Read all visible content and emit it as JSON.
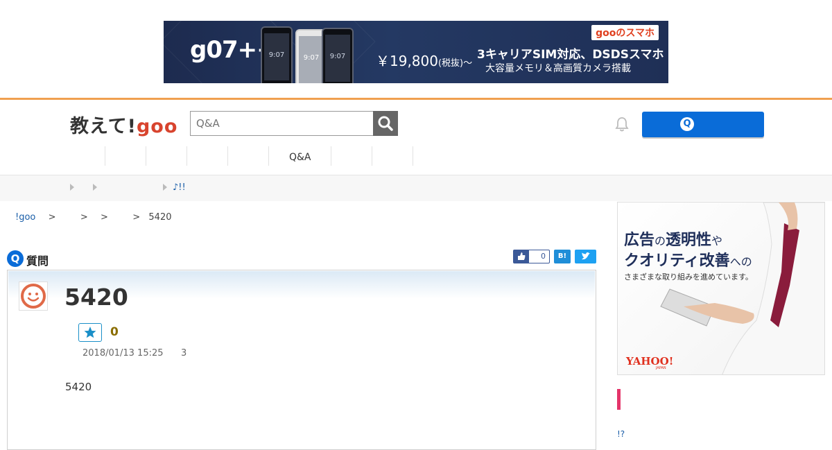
{
  "top_ad": {
    "model": "g07++",
    "phone_time": "9:07",
    "price": "￥19,800",
    "price_note": "(税抜)～",
    "headline": "3キャリアSIM対応、DSDSスマホ",
    "subline": "大容量メモリ＆高画質カメラ搭載",
    "brand": "gooのスマホ"
  },
  "header": {
    "logo_prefix": "教えて!",
    "logo_goo": "goo",
    "search_placeholder": "Q&A",
    "icons": {
      "search": "search-icon",
      "notification": "bell-icon",
      "ask": "q-circle-icon"
    },
    "ask_icon_text": "Q"
  },
  "nav": {
    "qa_label": "Q&A"
  },
  "notice_bar": {
    "text": "♪!!"
  },
  "breadcrumb": {
    "home": "!goo",
    "sep": ">",
    "current": "5420"
  },
  "question": {
    "icon_text": "Q",
    "section_label": "質問",
    "title": "5420",
    "star_count": "0",
    "date": "2018/01/13 15:25",
    "answer_count": "3",
    "body": "5420",
    "share": {
      "like_count": "0",
      "hatena_label": "B!"
    }
  },
  "side_ad": {
    "line1_a": "広告",
    "line1_b": "の",
    "line1_c": "透明性",
    "line1_d": "や",
    "line2_a": "クオリティ改善",
    "line2_b": "への",
    "line3": "さまざまな取り組みを進めています。",
    "brand": "YAHOO!",
    "brand_sub": "JAPAN"
  },
  "sidebar": {
    "link_text": "!?"
  },
  "colors": {
    "accent": "#0a6cd8",
    "header_line": "#f0a050",
    "goo_red": "#d8442e",
    "pink_marker": "#e4346a"
  }
}
